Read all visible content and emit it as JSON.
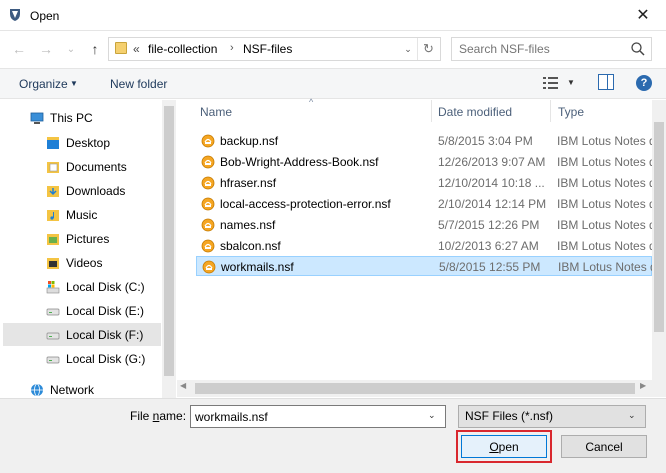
{
  "window": {
    "title": "Open",
    "close_glyph": "✕",
    "icon": "app-icon"
  },
  "nav": {
    "back_glyph": "←",
    "forward_glyph": "→",
    "recent_glyph": "⌄",
    "up_glyph": "↑",
    "breadcrumb": {
      "overflow": "«",
      "items": [
        "file-collection",
        "NSF-files"
      ],
      "separator": "›"
    },
    "dropdown_glyph": "⌄",
    "refresh_glyph": "↻",
    "search_placeholder": "Search NSF-files"
  },
  "toolbar": {
    "organize_label": "Organize",
    "organize_caret": "▼",
    "new_folder_label": "New folder",
    "view_caret": "▼",
    "help_glyph": "?"
  },
  "sidebar": {
    "this_pc": "This PC",
    "items": [
      {
        "label": "Desktop",
        "icon": "desktop-icon"
      },
      {
        "label": "Documents",
        "icon": "documents-icon"
      },
      {
        "label": "Downloads",
        "icon": "downloads-icon"
      },
      {
        "label": "Music",
        "icon": "music-icon"
      },
      {
        "label": "Pictures",
        "icon": "pictures-icon"
      },
      {
        "label": "Videos",
        "icon": "videos-icon"
      },
      {
        "label": "Local Disk (C:)",
        "icon": "drive-icon"
      },
      {
        "label": "Local Disk (E:)",
        "icon": "drive-icon"
      },
      {
        "label": "Local Disk (F:)",
        "icon": "drive-icon",
        "selected": true
      },
      {
        "label": "Local Disk (G:)",
        "icon": "drive-icon"
      }
    ],
    "network": "Network"
  },
  "list": {
    "columns": {
      "name": "Name",
      "date": "Date modified",
      "type": "Type"
    },
    "sort_glyph": "^",
    "files": [
      {
        "name": "backup.nsf",
        "date": "5/8/2015 3:04 PM",
        "type": "IBM Lotus Notes d..."
      },
      {
        "name": "Bob-Wright-Address-Book.nsf",
        "date": "12/26/2013 9:07 AM",
        "type": "IBM Lotus Notes d..."
      },
      {
        "name": "hfraser.nsf",
        "date": "12/10/2014 10:18 ...",
        "type": "IBM Lotus Notes d..."
      },
      {
        "name": "local-access-protection-error.nsf",
        "date": "2/10/2014 12:14 PM",
        "type": "IBM Lotus Notes d..."
      },
      {
        "name": "names.nsf",
        "date": "5/7/2015 12:26 PM",
        "type": "IBM Lotus Notes d..."
      },
      {
        "name": "sbalcon.nsf",
        "date": "10/2/2013 6:27 AM",
        "type": "IBM Lotus Notes d..."
      },
      {
        "name": "workmails.nsf",
        "date": "5/8/2015 12:55 PM",
        "type": "IBM Lotus Notes d...",
        "selected": true
      }
    ],
    "hscroll_left": "◀",
    "hscroll_right": "▶"
  },
  "footer": {
    "filename_label_pre": "File ",
    "filename_label_underline": "n",
    "filename_label_post": "ame:",
    "filename_value": "workmails.nsf",
    "dropdown_glyph": "⌄",
    "filetype_value": "NSF Files (*.nsf)",
    "open_label_underline": "O",
    "open_label_rest": "pen",
    "cancel_label": "Cancel"
  },
  "colors": {
    "accent": "#0078d7",
    "highlight": "#d9272e",
    "selection": "#cce8ff",
    "nsf_icon": "#f5a623"
  }
}
